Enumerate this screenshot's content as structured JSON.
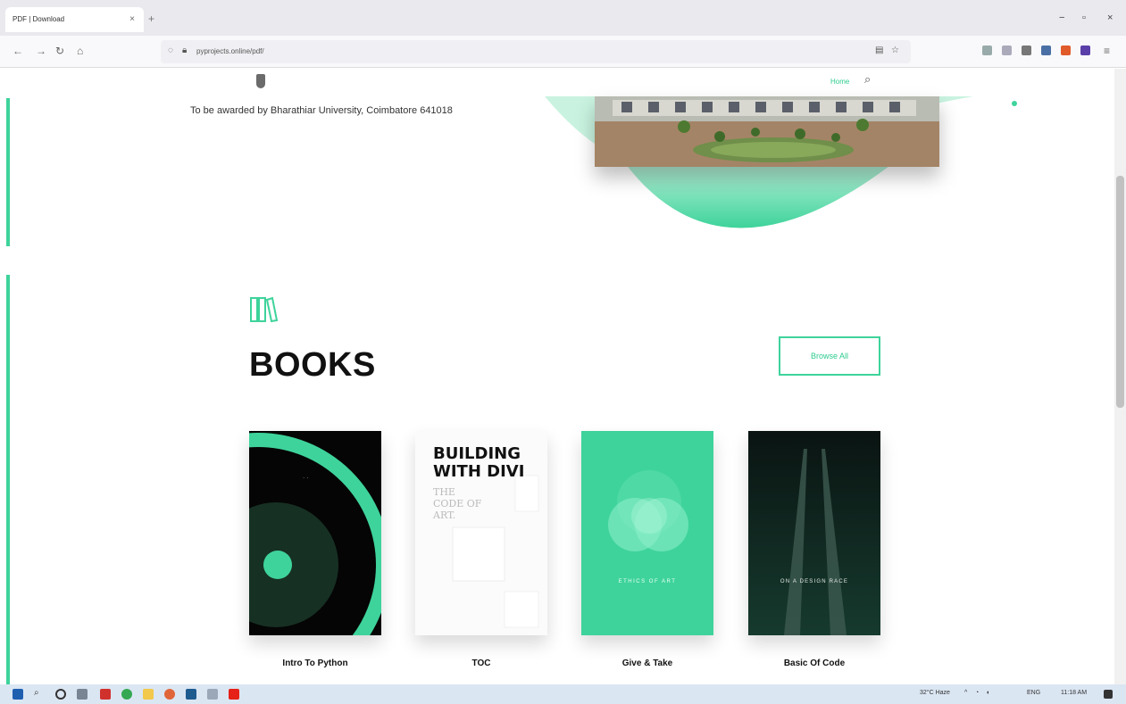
{
  "browser": {
    "tab_title": "PDF | Download",
    "tab_close": "×",
    "new_tab": "+",
    "url": "pyprojects.online/pdf/",
    "window_controls": [
      "−",
      "▫",
      "×"
    ]
  },
  "site": {
    "nav_home": "Home",
    "award_text": "To be awarded by Bharathiar University, Coimbatore 641018",
    "section_title": "BOOKS",
    "browse_label": "Browse All",
    "books": [
      {
        "label": "Intro To Python"
      },
      {
        "label": "TOC",
        "cover_lines": [
          "BUILDING",
          "WITH DIVI",
          "THE",
          "CODE OF",
          "ART."
        ]
      },
      {
        "label": "Give & Take",
        "cover_text": "ETHICS OF ART"
      },
      {
        "label": "Basic Of Code",
        "cover_text": "ON A DESIGN RACE"
      }
    ]
  },
  "taskbar": {
    "weather": "32°C Haze",
    "language": "ENG",
    "time": "11:18 AM"
  },
  "colors": {
    "accent": "#3ed39b",
    "dark": "#0a0a0a",
    "cover_green": "#3ed39b",
    "cover_dark": "#0d1f1a"
  }
}
